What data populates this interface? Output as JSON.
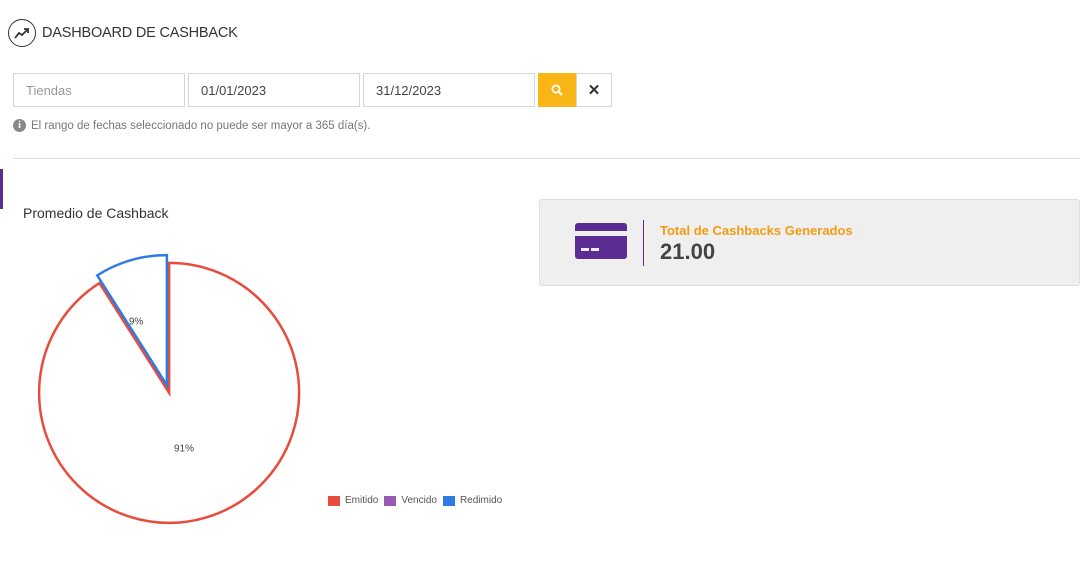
{
  "header": {
    "title": "DASHBOARD DE CASHBACK",
    "icon": "trending-up-icon"
  },
  "filters": {
    "store_placeholder": "Tiendas",
    "start_date": "01/01/2023",
    "end_date": "31/12/2023",
    "search_icon": "search-icon",
    "clear_icon": "close-icon"
  },
  "hint": {
    "icon": "info-icon",
    "text": "El rango de fechas seleccionado no puede ser mayor a 365 día(s)."
  },
  "chart": {
    "title": "Promedio de Cashback"
  },
  "chart_data": {
    "type": "pie",
    "title": "Promedio de Cashback",
    "categories": [
      "Emitido",
      "Vencido",
      "Redimido"
    ],
    "values": [
      91,
      0,
      9
    ],
    "value_labels": [
      "91%",
      "",
      "9%"
    ],
    "colors": [
      "#e74c3c",
      "#9b59b6",
      "#2e7be4"
    ],
    "legend_position": "bottom-right"
  },
  "legend": [
    {
      "label": "Emitido",
      "color": "#e74c3c"
    },
    {
      "label": "Vencido",
      "color": "#9b59b6"
    },
    {
      "label": "Redimido",
      "color": "#2e7be4"
    }
  ],
  "summary_card": {
    "icon": "credit-card-icon",
    "label": "Total de Cashbacks Generados",
    "value": "21.00",
    "accent_color": "#5b2c91",
    "label_color": "#f39c12"
  }
}
